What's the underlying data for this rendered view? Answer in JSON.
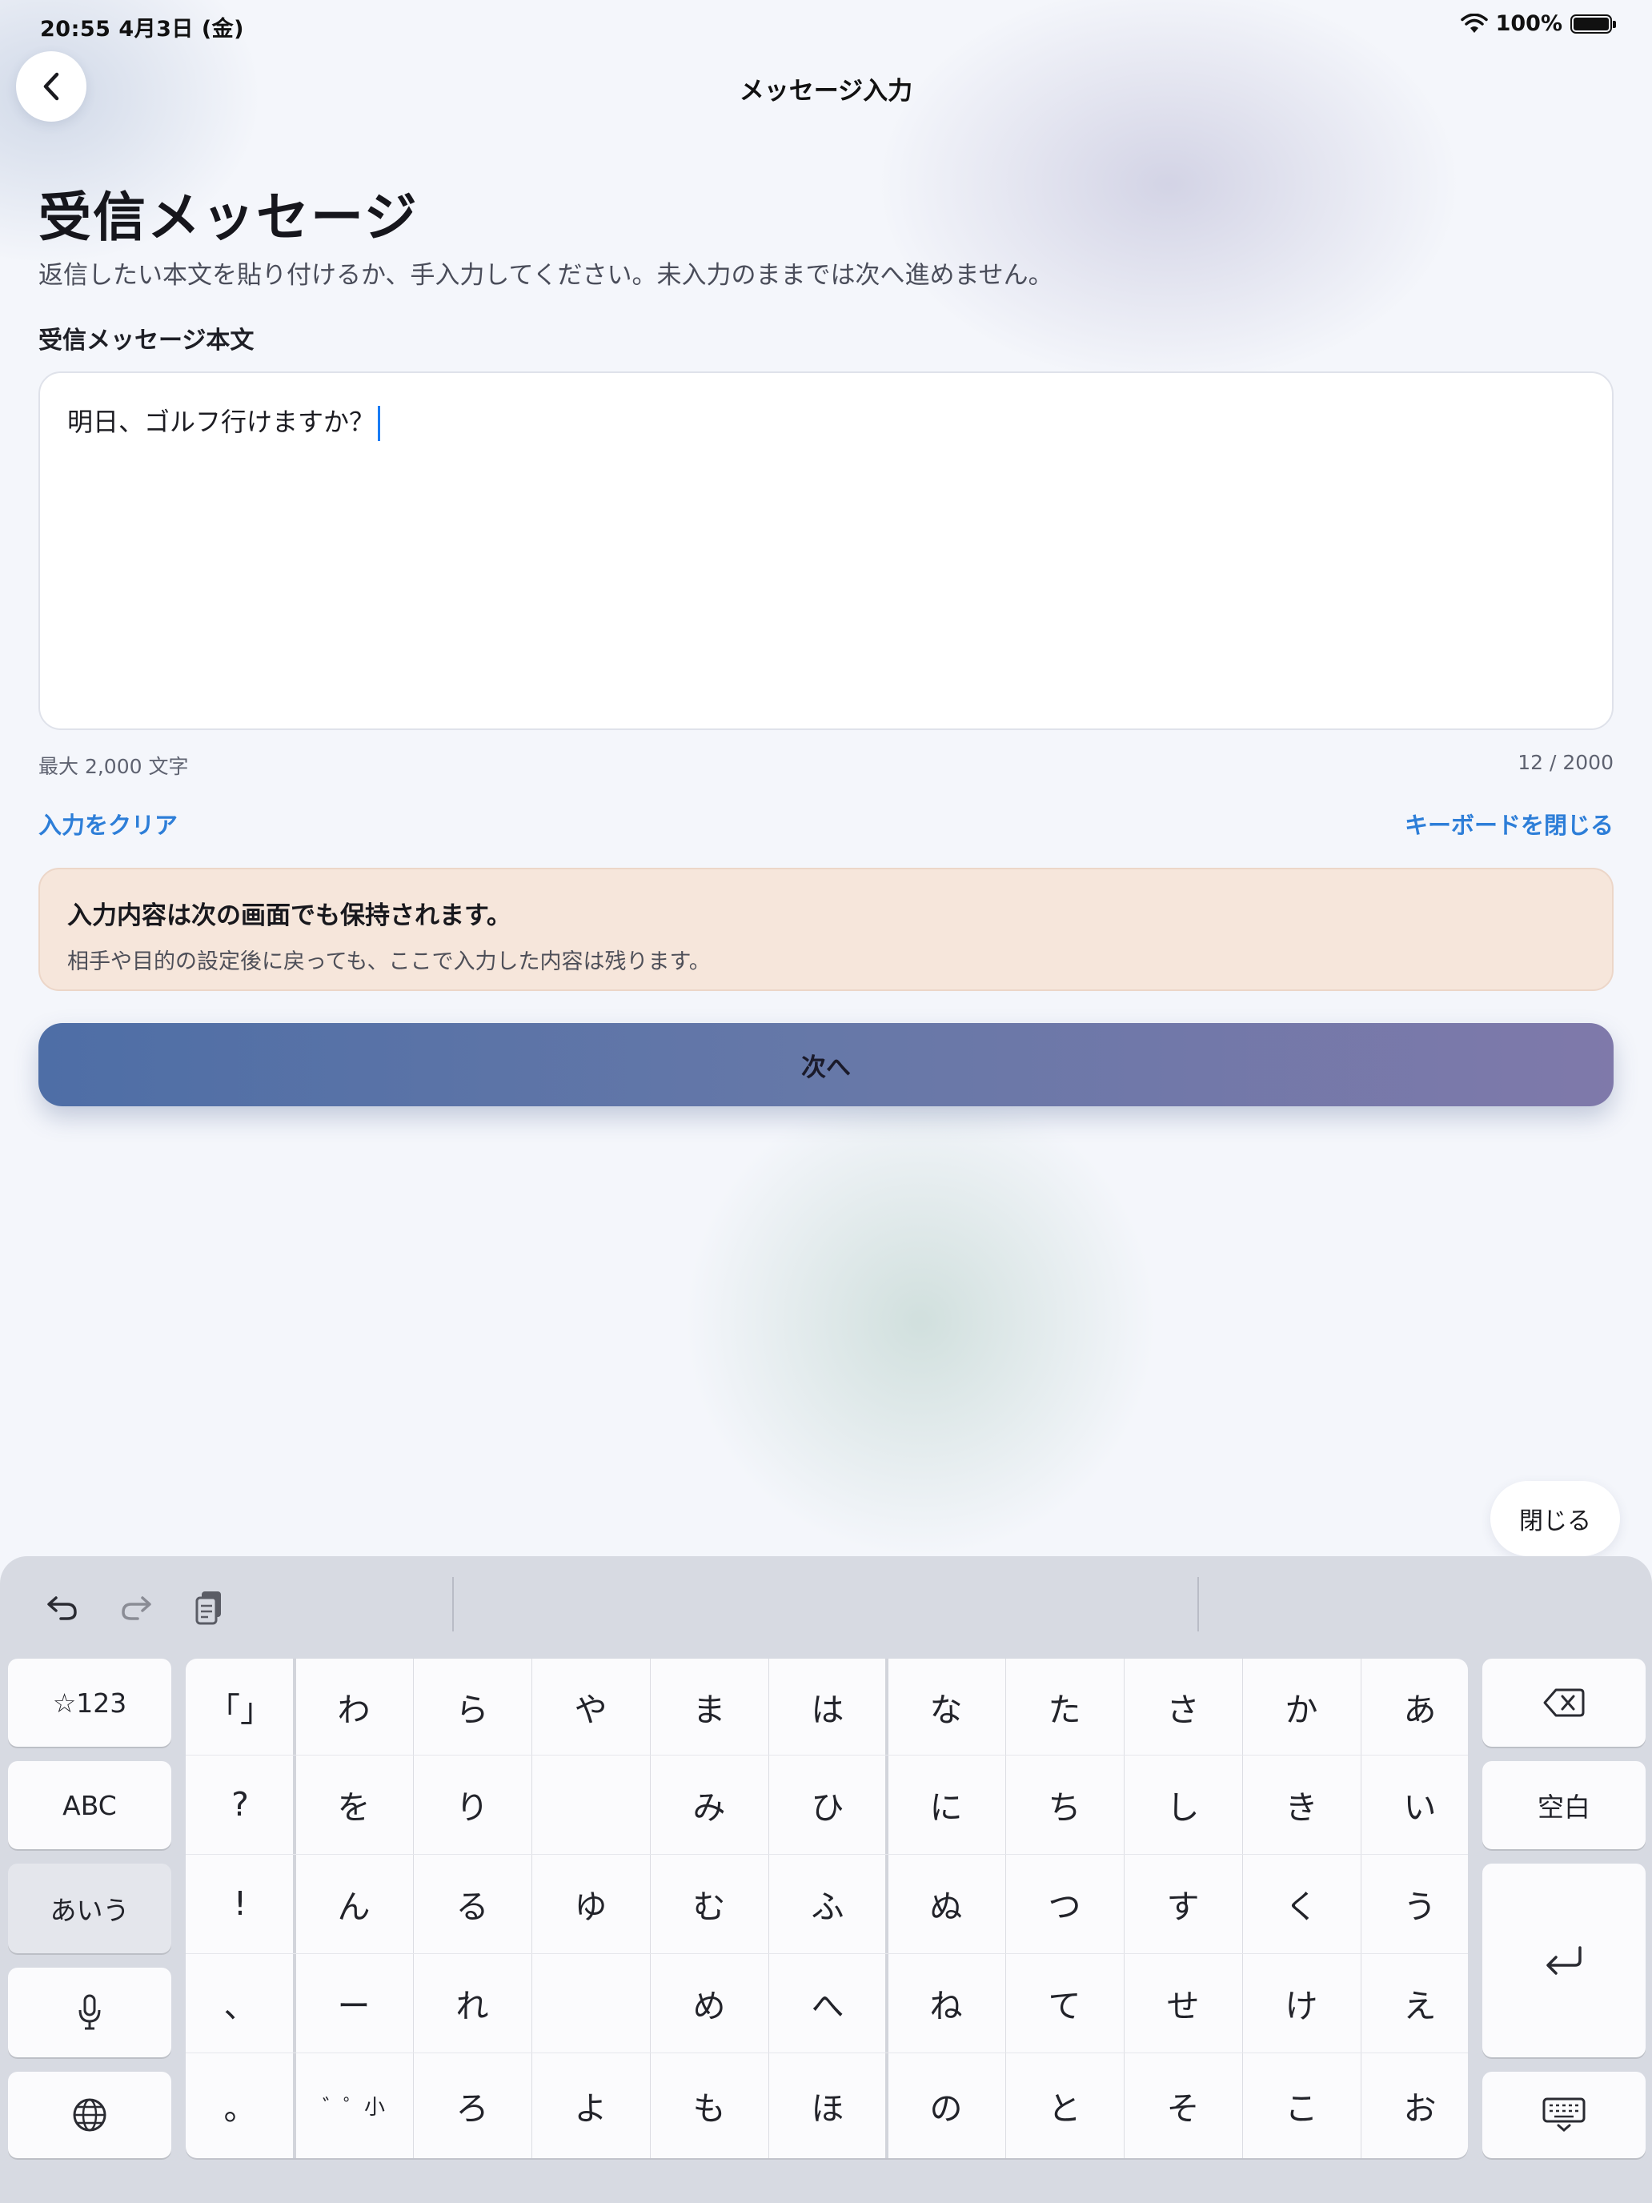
{
  "status_bar": {
    "time_date": "20:55   4月3日 (金)",
    "battery": "100%",
    "battery_level": 1.0
  },
  "nav": {
    "title": "メッセージ入力"
  },
  "page": {
    "title": "受信メッセージ",
    "description": "返信したい本文を貼り付けるか、手入力してください。未入力のままでは次へ進めません。"
  },
  "field": {
    "label": "受信メッセージ本文",
    "value": "明日、ゴルフ行けますか？",
    "max_hint": "最大 2,000 文字",
    "counter": "12 / 2000"
  },
  "actions": {
    "clear": "入力をクリア",
    "close_keyboard": "キーボードを閉じる"
  },
  "notice": {
    "title": "入力内容は次の画面でも保持されます。",
    "body": "相手や目的の設定後に戻っても、ここで入力した内容は残ります。"
  },
  "next_button": "次へ",
  "close_pill": "閉じる",
  "keyboard": {
    "left_keys": [
      "☆123",
      "ABC",
      "あいう"
    ],
    "active_mode": "あいう",
    "right_keys": {
      "space": "空白"
    },
    "kana_grid": [
      [
        "「」",
        "わ",
        "ら",
        "や",
        "ま",
        "は",
        "な",
        "た",
        "さ",
        "か",
        "あ"
      ],
      [
        "?",
        "を",
        "り",
        "",
        "み",
        "ひ",
        "に",
        "ち",
        "し",
        "き",
        "い"
      ],
      [
        "!",
        "ん",
        "る",
        "ゆ",
        "む",
        "ふ",
        "ぬ",
        "つ",
        "す",
        "く",
        "う"
      ],
      [
        "、",
        "ー",
        "れ",
        "",
        "め",
        "へ",
        "ね",
        "て",
        "せ",
        "け",
        "え"
      ],
      [
        "。",
        "゛゜小",
        "ろ",
        "よ",
        "も",
        "ほ",
        "の",
        "と",
        "そ",
        "こ",
        "お"
      ]
    ]
  },
  "colors": {
    "accent_link": "#2d7ed8",
    "caret": "#1a7cf5",
    "notice_bg": "#f6e6db",
    "button_gradient_start": "#4e6ea6",
    "button_gradient_end": "#7f79aa"
  }
}
